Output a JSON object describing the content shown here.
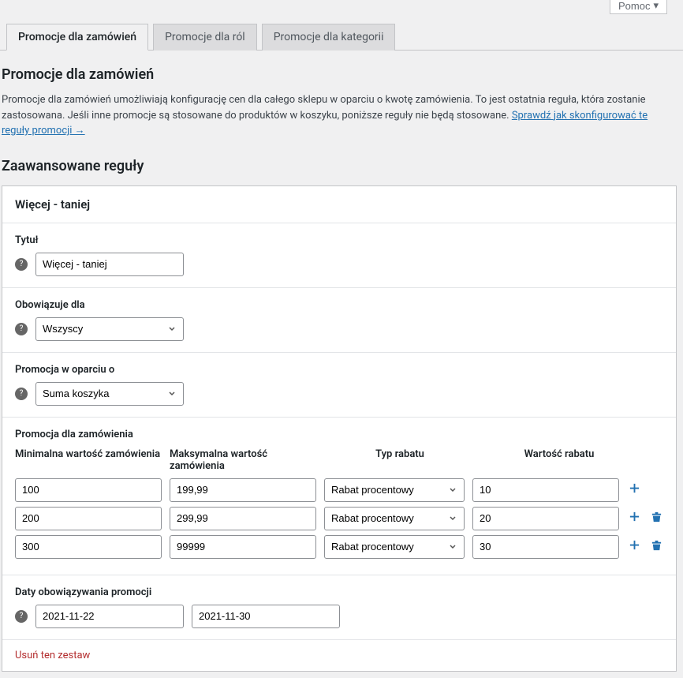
{
  "help_button": "Pomoc",
  "tabs": [
    {
      "label": "Promocje dla zamówień"
    },
    {
      "label": "Promocje dla ról"
    },
    {
      "label": "Promocje dla kategorii"
    }
  ],
  "heading": "Promocje dla zamówień",
  "description_1": "Promocje dla zamówień umożliwiają konfigurację cen dla całego sklepu w oparciu o kwotę zamówienia. To jest ostatnia reguła, która zostanie zastosowana. Jeśli inne promocje są stosowane do produktów w koszyku, poniższe reguły nie będą stosowane. ",
  "description_link": "Sprawdź jak skonfigurować te reguły promocji →",
  "advanced_heading": "Zaawansowane reguły",
  "panel_title": "Więcej - taniej",
  "title_label": "Tytuł",
  "title_value": "Więcej - taniej",
  "applies_label": "Obowiązuje dla",
  "applies_value": "Wszyscy",
  "based_on_label": "Promocja w oparciu o",
  "based_on_value": "Suma koszyka",
  "order_promo_label": "Promocja dla zamówienia",
  "col_min": "Minimalna wartość zamówienia",
  "col_max": "Maksymalna wartość zamówienia",
  "col_type": "Typ rabatu",
  "col_value": "Wartość rabatu",
  "discount_type": "Rabat procentowy",
  "rows": [
    {
      "min": "100",
      "max": "199,99",
      "type": "Rabat procentowy",
      "value": "10",
      "has_delete": false
    },
    {
      "min": "200",
      "max": "299,99",
      "type": "Rabat procentowy",
      "value": "20",
      "has_delete": true
    },
    {
      "min": "300",
      "max": "99999",
      "type": "Rabat procentowy",
      "value": "30",
      "has_delete": true
    }
  ],
  "dates_label": "Daty obowiązywania promocji",
  "date_from": "2021-11-22",
  "date_to": "2021-11-30",
  "delete_set": "Usuń ten zestaw"
}
